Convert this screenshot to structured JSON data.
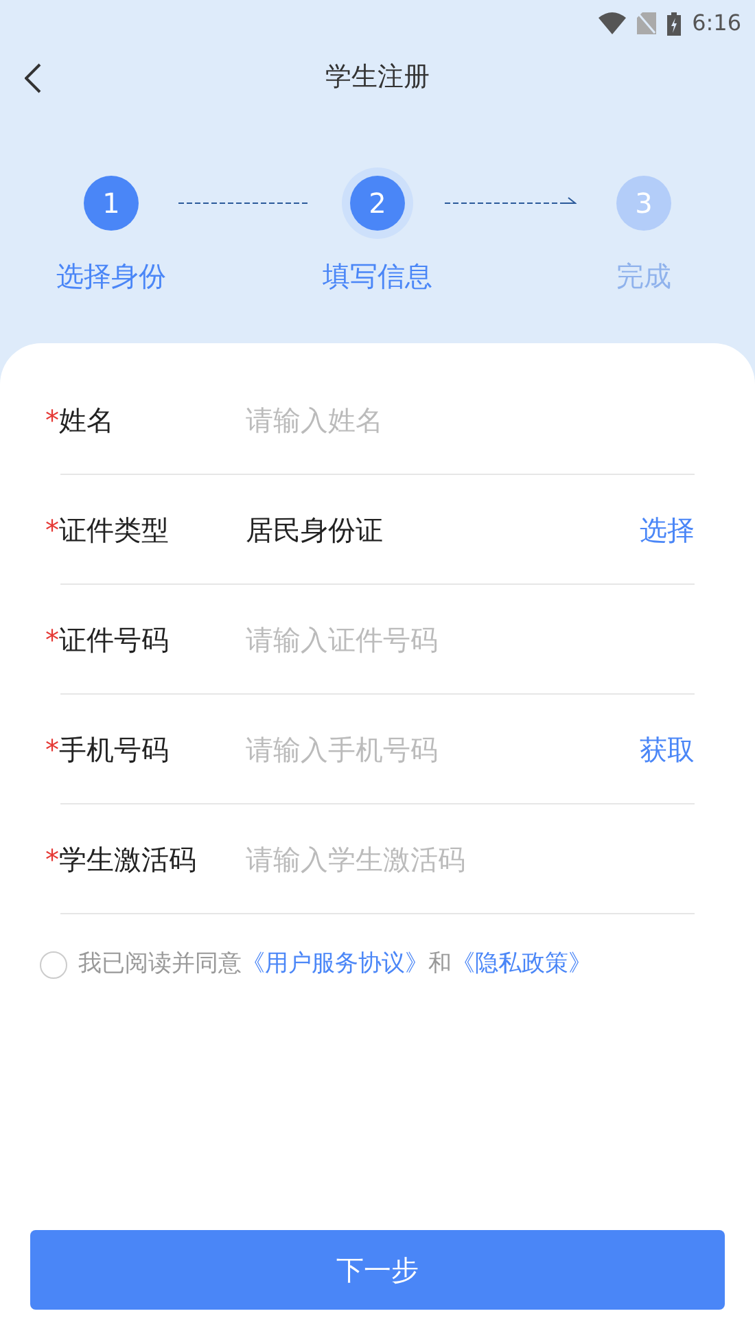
{
  "status_bar": {
    "time": "6:16"
  },
  "header": {
    "title": "学生注册"
  },
  "steps": [
    {
      "number": "1",
      "label": "选择身份",
      "reached": true,
      "selected": false
    },
    {
      "number": "2",
      "label": "填写信息",
      "reached": true,
      "selected": true
    },
    {
      "number": "3",
      "label": "完成",
      "reached": false,
      "selected": false
    }
  ],
  "fields": [
    {
      "kind": "input",
      "required_mark": "*",
      "label": "姓名",
      "placeholder": "请输入姓名"
    },
    {
      "kind": "select",
      "required_mark": "*",
      "label": "证件类型",
      "value": "居民身份证",
      "action": "选择"
    },
    {
      "kind": "input",
      "required_mark": "*",
      "label": "证件号码",
      "placeholder": "请输入证件号码"
    },
    {
      "kind": "input",
      "required_mark": "*",
      "label": "手机号码",
      "placeholder": "请输入手机号码",
      "action": "获取"
    },
    {
      "kind": "input",
      "required_mark": "*",
      "label": "学生激活码",
      "placeholder": "请输入学生激活码"
    }
  ],
  "agreement": {
    "checked": false,
    "text": "我已阅读并同意",
    "link_1": "《用户服务协议》",
    "joiner": "和",
    "link_2": "《隐私政策》"
  },
  "next_button": "下一步"
}
